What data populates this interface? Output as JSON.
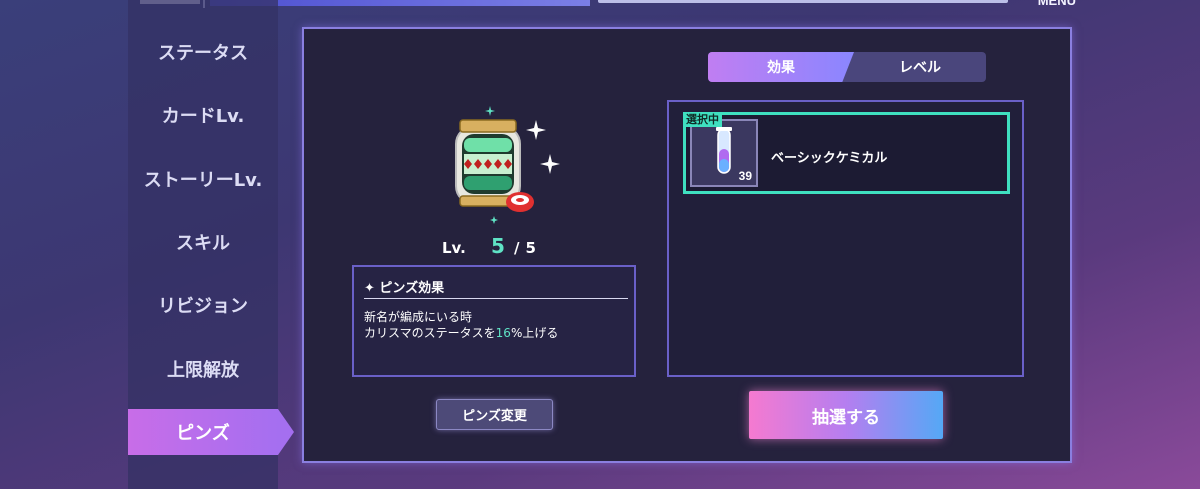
{
  "header": {
    "menu_label": "MENU"
  },
  "sidebar": {
    "items": [
      {
        "label": "ステータス",
        "active": false
      },
      {
        "label": "カードLv.",
        "active": false
      },
      {
        "label": "ストーリーLv.",
        "active": false
      },
      {
        "label": "スキル",
        "active": false
      },
      {
        "label": "リビジョン",
        "active": false
      },
      {
        "label": "上限解放",
        "active": false
      },
      {
        "label": "ピンズ",
        "active": true
      }
    ]
  },
  "tabs": [
    {
      "label": "効果",
      "active": true
    },
    {
      "label": "レベル",
      "active": false
    }
  ],
  "pin": {
    "level_label": "Lv.",
    "level": "5",
    "separator": "/",
    "max_level": "5"
  },
  "effect": {
    "title": "✦ ピンズ効果",
    "line1": "新名が編成にいる時",
    "line2_prefix": "カリスマのステータスを",
    "line2_value": "16",
    "line2_suffix": "%上げる"
  },
  "change_button": "ピンズ変更",
  "item_list": [
    {
      "badge": "選択中",
      "name": "ベーシックケミカル",
      "count": "39",
      "selected": true
    }
  ],
  "draw_button": "抽選する",
  "colors": {
    "accent_teal": "#3fe0c0",
    "accent_pink": "#f57ad0",
    "panel_border": "#8a7fe0"
  }
}
